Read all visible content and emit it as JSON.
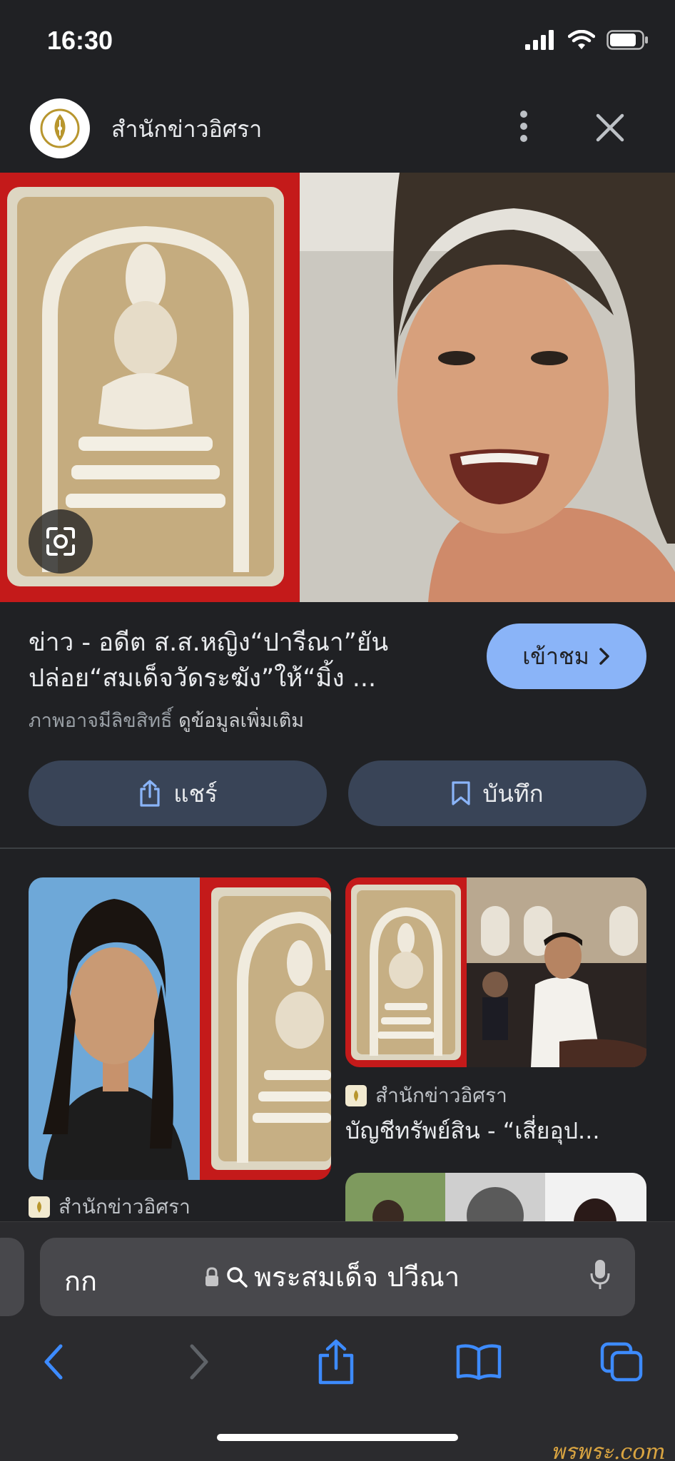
{
  "status_bar": {
    "time": "16:30"
  },
  "header": {
    "site_name": "สำนักข่าวอิศรา"
  },
  "result": {
    "title_line1": "ข่าว - อดีต ส.ส.หญิง“ปารีณา”ยัน",
    "title_line2": "ปล่อย“สมเด็จวัดระฆัง”ให้“มิ้ง ...",
    "visit_label": "เข้าชม",
    "copyright_text": "ภาพอาจมีลิขสิทธิ์",
    "more_info_label": "ดูข้อมูลเพิ่มเติม"
  },
  "actions": {
    "share_label": "แชร์",
    "save_label": "บันทึก"
  },
  "related": [
    {
      "source": "สำนักข่าวอิศรา",
      "title": ""
    },
    {
      "source": "สำนักข่าวอิศรา",
      "title": "บัญชีทรัพย์สิน - “เสี่ยอุป..."
    }
  ],
  "browser": {
    "aa_label": "กก",
    "address_text": "พระสมเด็จ ปวีณา"
  },
  "watermark": "พรพระ.com",
  "colors": {
    "background": "#202124",
    "accent": "#8ab4f8",
    "button": "#394457",
    "browser_bar": "#2b2b2e"
  }
}
